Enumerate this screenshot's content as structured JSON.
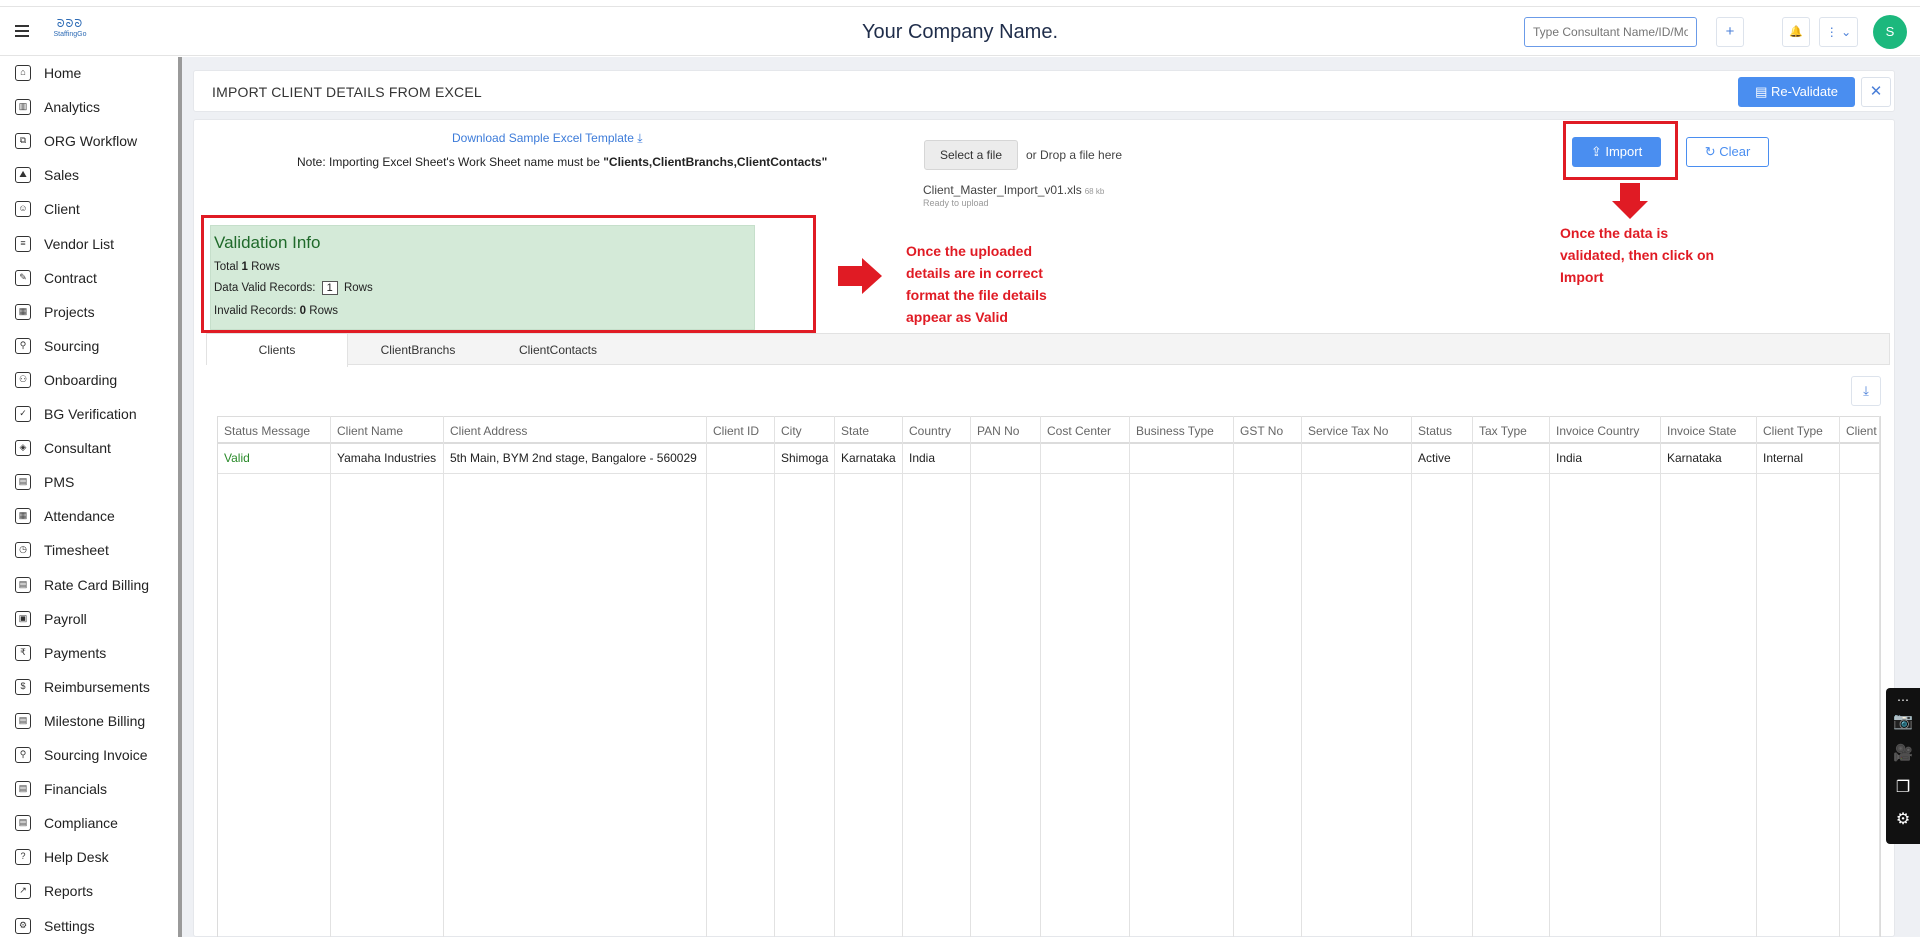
{
  "header": {
    "logo_mark": "ᘐᘐᘐ",
    "logo_text": "StaffingGo",
    "company_name": "Your Company Name.",
    "search_placeholder": "Type Consultant Name/ID/Mobile/...",
    "plus_icon": "+",
    "bell_icon": "🔔",
    "more_icon": "⋮ ⌄",
    "avatar_letter": "S"
  },
  "sidebar": {
    "items": [
      {
        "label": "Home",
        "icon": "⌂"
      },
      {
        "label": "Analytics",
        "icon": "▥"
      },
      {
        "label": "ORG Workflow",
        "icon": "⧉"
      },
      {
        "label": "Sales",
        "icon": "⛰"
      },
      {
        "label": "Client",
        "icon": "☺"
      },
      {
        "label": "Vendor List",
        "icon": "≡"
      },
      {
        "label": "Contract",
        "icon": "✎"
      },
      {
        "label": "Projects",
        "icon": "▦"
      },
      {
        "label": "Sourcing",
        "icon": "⚲"
      },
      {
        "label": "Onboarding",
        "icon": "⚇"
      },
      {
        "label": "BG Verification",
        "icon": "✓"
      },
      {
        "label": "Consultant",
        "icon": "◈"
      },
      {
        "label": "PMS",
        "icon": "▤"
      },
      {
        "label": "Attendance",
        "icon": "▦"
      },
      {
        "label": "Timesheet",
        "icon": "◷"
      },
      {
        "label": "Rate Card Billing",
        "icon": "▤"
      },
      {
        "label": "Payroll",
        "icon": "▣"
      },
      {
        "label": "Payments",
        "icon": "₹"
      },
      {
        "label": "Reimbursements",
        "icon": "$"
      },
      {
        "label": "Milestone Billing",
        "icon": "▤"
      },
      {
        "label": "Sourcing Invoice",
        "icon": "⚲"
      },
      {
        "label": "Financials",
        "icon": "▤"
      },
      {
        "label": "Compliance",
        "icon": "▤"
      },
      {
        "label": "Help Desk",
        "icon": "?"
      },
      {
        "label": "Reports",
        "icon": "↗"
      },
      {
        "label": "Settings",
        "icon": "⚙"
      }
    ]
  },
  "page": {
    "title": "IMPORT CLIENT DETAILS FROM EXCEL",
    "revalidate_label": "Re-Validate",
    "close_icon": "✕"
  },
  "upload": {
    "download_link": "Download Sample Excel Template",
    "download_icon": "⤓",
    "note_prefix": "Note: Importing Excel Sheet's Work Sheet name must be ",
    "note_sheets": "\"Clients,ClientBranchs,ClientContacts\"",
    "select_file_label": "Select a file",
    "drop_text": "or Drop a file here",
    "file_name": "Client_Master_Import_v01.xls",
    "file_size": "68 kb",
    "file_status": "Ready to upload",
    "import_label": "Import",
    "import_icon": "⇪",
    "clear_label": "Clear",
    "clear_icon": "↻"
  },
  "validation": {
    "title": "Validation Info",
    "total_prefix": "Total ",
    "total_count": "1",
    "total_suffix": " Rows",
    "valid_prefix": "Data Valid Records: ",
    "valid_count": "1",
    "valid_suffix": " Rows",
    "invalid_prefix": "Invalid Records: ",
    "invalid_count": "0",
    "invalid_suffix": " Rows"
  },
  "annotations": {
    "validation_note": [
      "Once the uploaded",
      "details are in correct",
      "format the file details",
      "appear as Valid"
    ],
    "import_note": [
      "Once the data is",
      "validated, then click on",
      "Import"
    ],
    "color": "#e01b24"
  },
  "tabs": [
    "Clients",
    "ClientBranchs",
    "ClientContacts"
  ],
  "table": {
    "download_icon": "⤓",
    "columns": [
      "Status Message",
      "Client Name",
      "Client Address",
      "Client ID",
      "City",
      "State",
      "Country",
      "PAN No",
      "Cost Center",
      "Business Type",
      "GST No",
      "Service Tax No",
      "Status",
      "Tax Type",
      "Invoice Country",
      "Invoice State",
      "Client Type",
      "Client"
    ],
    "rows": [
      [
        "Valid",
        "Yamaha Industries",
        "5th Main, BYM 2nd stage, Bangalore - 560029",
        "",
        "Shimoga",
        "Karnataka",
        "India",
        "",
        "",
        "",
        "",
        "",
        "Active",
        "",
        "India",
        "Karnataka",
        "Internal",
        ""
      ]
    ]
  },
  "tools": {
    "icons": [
      "⋯",
      "📷",
      "🎥",
      "❐",
      "⚙"
    ]
  },
  "colors": {
    "accent": "#4a8ef0",
    "valid_bg": "#d4ead8",
    "valid_text": "#2a8a2a",
    "avatar": "#1cb87d"
  }
}
